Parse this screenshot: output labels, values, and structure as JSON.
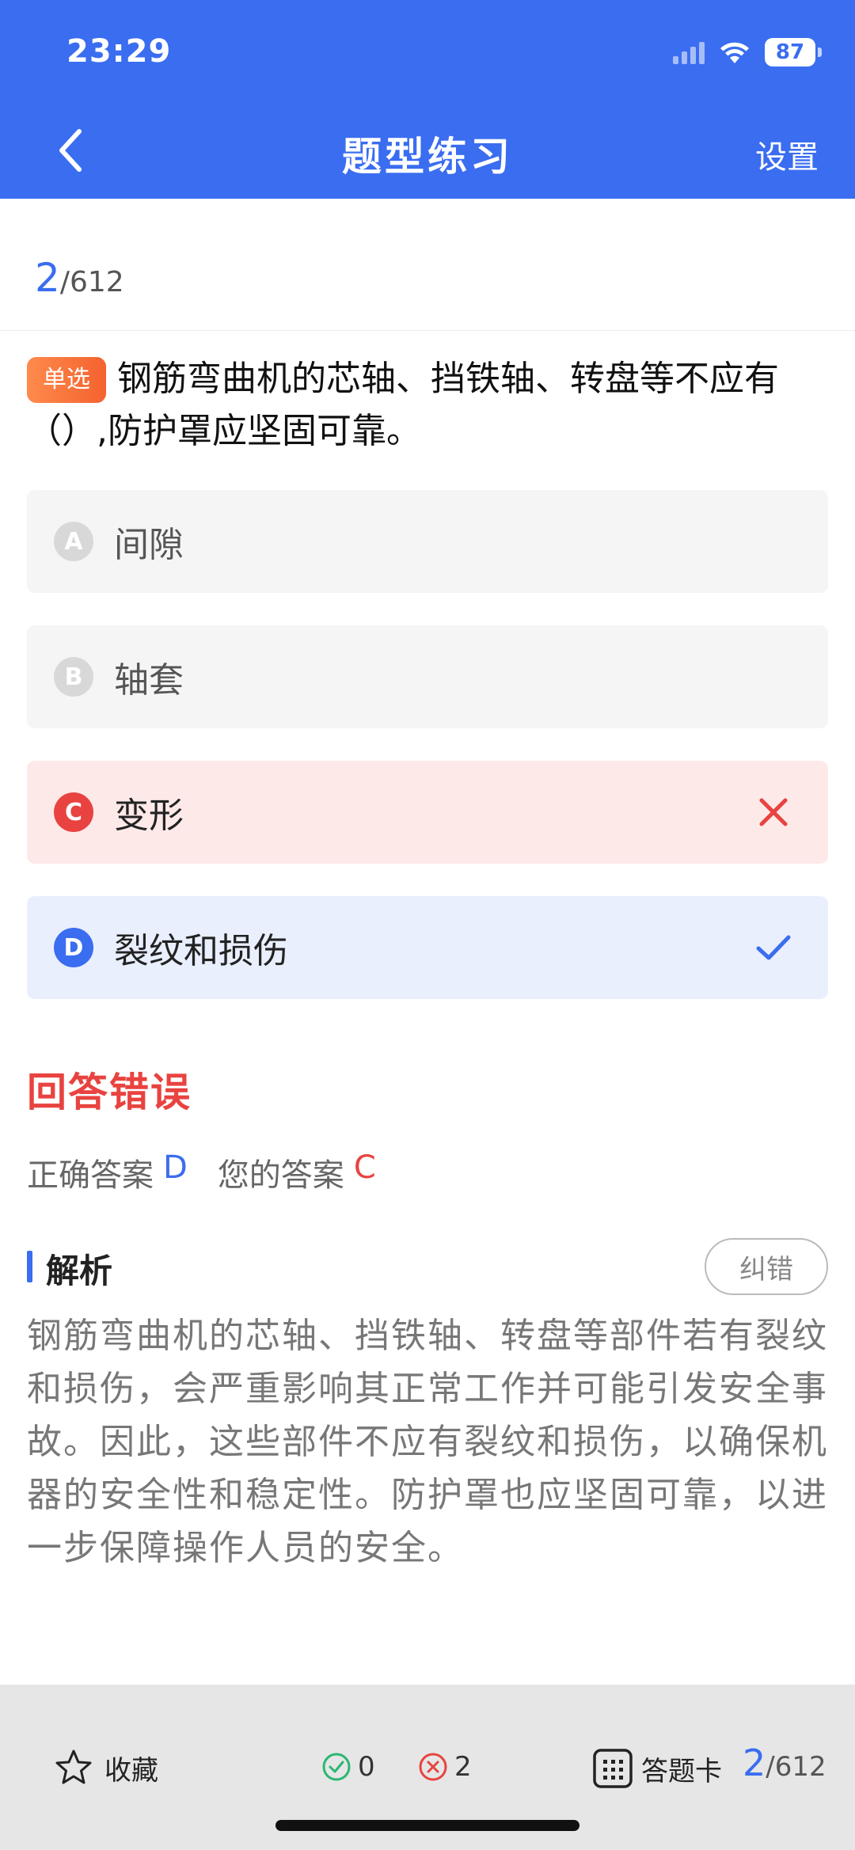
{
  "status": {
    "time": "23:29",
    "battery": "87"
  },
  "header": {
    "title": "题型练习",
    "settings": "设置"
  },
  "counter": {
    "current": "2",
    "total": "/612"
  },
  "question": {
    "type": "单选",
    "text": "钢筋弯曲机的芯轴、挡铁轴、转盘等不应有（）,防护罩应坚固可靠。"
  },
  "options": [
    {
      "letter": "A",
      "text": "间隙",
      "state": "normal"
    },
    {
      "letter": "B",
      "text": "轴套",
      "state": "normal"
    },
    {
      "letter": "C",
      "text": "变形",
      "state": "wrong"
    },
    {
      "letter": "D",
      "text": "裂纹和损伤",
      "state": "correct"
    }
  ],
  "result": {
    "title": "回答错误",
    "correct_label": "正确答案",
    "correct_value": "D",
    "yours_label": "您的答案",
    "yours_value": "C"
  },
  "analysis": {
    "title": "解析",
    "fix_label": "纠错",
    "text": "钢筋弯曲机的芯轴、挡铁轴、转盘等部件若有裂纹和损伤，会严重影响其正常工作并可能引发安全事故。因此，这些部件不应有裂纹和损伤，以确保机器的安全性和稳定性。防护罩也应坚固可靠，以进一步保障操作人员的安全。"
  },
  "bottom": {
    "favorite_label": "收藏",
    "correct_count": "0",
    "wrong_count": "2",
    "card_label": "答题卡",
    "page_current": "2",
    "page_total": "/612"
  },
  "colors": {
    "primary": "#3a6df0",
    "error": "#e84340",
    "success": "#2bb673",
    "tag": "#f4622f"
  },
  "icons": [
    "back-arrow-icon",
    "check-icon",
    "close-icon",
    "star-icon",
    "correct-circle-icon",
    "wrong-circle-icon",
    "grid-icon"
  ]
}
